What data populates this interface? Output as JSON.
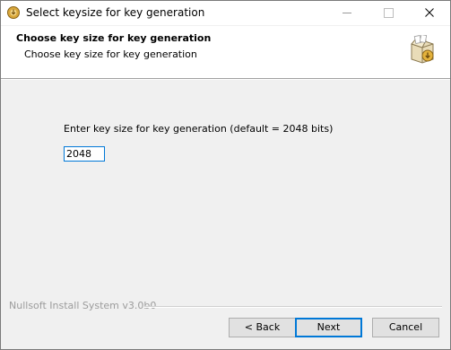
{
  "window": {
    "title": "Select keysize for key generation",
    "icon": "nsis-installer-icon"
  },
  "header": {
    "title": "Choose key size for key generation",
    "subtitle": "Choose key size for key generation",
    "icon": "installer-box-icon"
  },
  "form": {
    "prompt": "Enter key size for key generation (default = 2048 bits)",
    "keysize_value": "2048"
  },
  "footer": {
    "branding": "Nullsoft Install System v3.0b0",
    "back_label": "< Back",
    "next_label": "Next",
    "cancel_label": "Cancel"
  },
  "colors": {
    "accent": "#0078d7",
    "button_face": "#e1e1e1",
    "dialog_bg": "#f0f0f0"
  }
}
